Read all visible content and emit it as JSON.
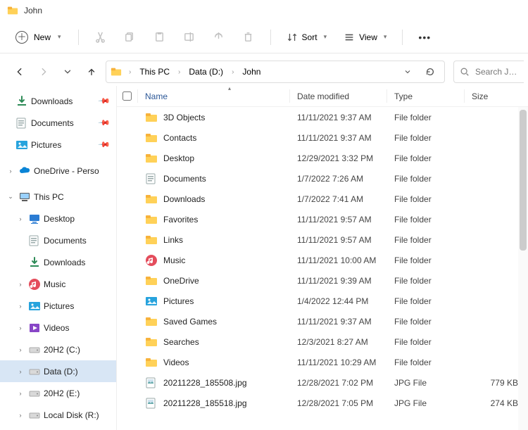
{
  "window": {
    "title": "John"
  },
  "toolbar": {
    "new_label": "New",
    "sort_label": "Sort",
    "view_label": "View"
  },
  "breadcrumbs": {
    "parts": {
      "p0": "This PC",
      "p1": "Data (D:)",
      "p2": "John"
    }
  },
  "search": {
    "placeholder": "Search John"
  },
  "columns": {
    "name": "Name",
    "date": "Date modified",
    "type": "Type",
    "size": "Size"
  },
  "sidebar": {
    "quick": {
      "downloads": "Downloads",
      "documents": "Documents",
      "pictures": "Pictures"
    },
    "onedrive": "OneDrive - Perso",
    "thispc": "This PC",
    "pc": {
      "desktop": "Desktop",
      "documents": "Documents",
      "downloads": "Downloads",
      "music": "Music",
      "pictures": "Pictures",
      "videos": "Videos",
      "drive_c": "20H2 (C:)",
      "drive_d": "Data (D:)",
      "drive_e": "20H2 (E:)",
      "drive_r": "Local Disk (R:)"
    }
  },
  "files": {
    "r0": {
      "name": "3D Objects",
      "date": "11/11/2021 9:37 AM",
      "type": "File folder",
      "size": "",
      "icon": "folder"
    },
    "r1": {
      "name": "Contacts",
      "date": "11/11/2021 9:37 AM",
      "type": "File folder",
      "size": "",
      "icon": "folder"
    },
    "r2": {
      "name": "Desktop",
      "date": "12/29/2021 3:32 PM",
      "type": "File folder",
      "size": "",
      "icon": "folder"
    },
    "r3": {
      "name": "Documents",
      "date": "1/7/2022 7:26 AM",
      "type": "File folder",
      "size": "",
      "icon": "docfolder"
    },
    "r4": {
      "name": "Downloads",
      "date": "1/7/2022 7:41 AM",
      "type": "File folder",
      "size": "",
      "icon": "folder"
    },
    "r5": {
      "name": "Favorites",
      "date": "11/11/2021 9:57 AM",
      "type": "File folder",
      "size": "",
      "icon": "folder"
    },
    "r6": {
      "name": "Links",
      "date": "11/11/2021 9:57 AM",
      "type": "File folder",
      "size": "",
      "icon": "folder"
    },
    "r7": {
      "name": "Music",
      "date": "11/11/2021 10:00 AM",
      "type": "File folder",
      "size": "",
      "icon": "music"
    },
    "r8": {
      "name": "OneDrive",
      "date": "11/11/2021 9:39 AM",
      "type": "File folder",
      "size": "",
      "icon": "folder"
    },
    "r9": {
      "name": "Pictures",
      "date": "1/4/2022 12:44 PM",
      "type": "File folder",
      "size": "",
      "icon": "pictures"
    },
    "r10": {
      "name": "Saved Games",
      "date": "11/11/2021 9:37 AM",
      "type": "File folder",
      "size": "",
      "icon": "folder"
    },
    "r11": {
      "name": "Searches",
      "date": "12/3/2021 8:27 AM",
      "type": "File folder",
      "size": "",
      "icon": "folder"
    },
    "r12": {
      "name": "Videos",
      "date": "11/11/2021 10:29 AM",
      "type": "File folder",
      "size": "",
      "icon": "folder"
    },
    "r13": {
      "name": "20211228_185508.jpg",
      "date": "12/28/2021 7:02 PM",
      "type": "JPG File",
      "size": "779 KB",
      "icon": "image"
    },
    "r14": {
      "name": "20211228_185518.jpg",
      "date": "12/28/2021 7:05 PM",
      "type": "JPG File",
      "size": "274 KB",
      "icon": "image"
    }
  }
}
